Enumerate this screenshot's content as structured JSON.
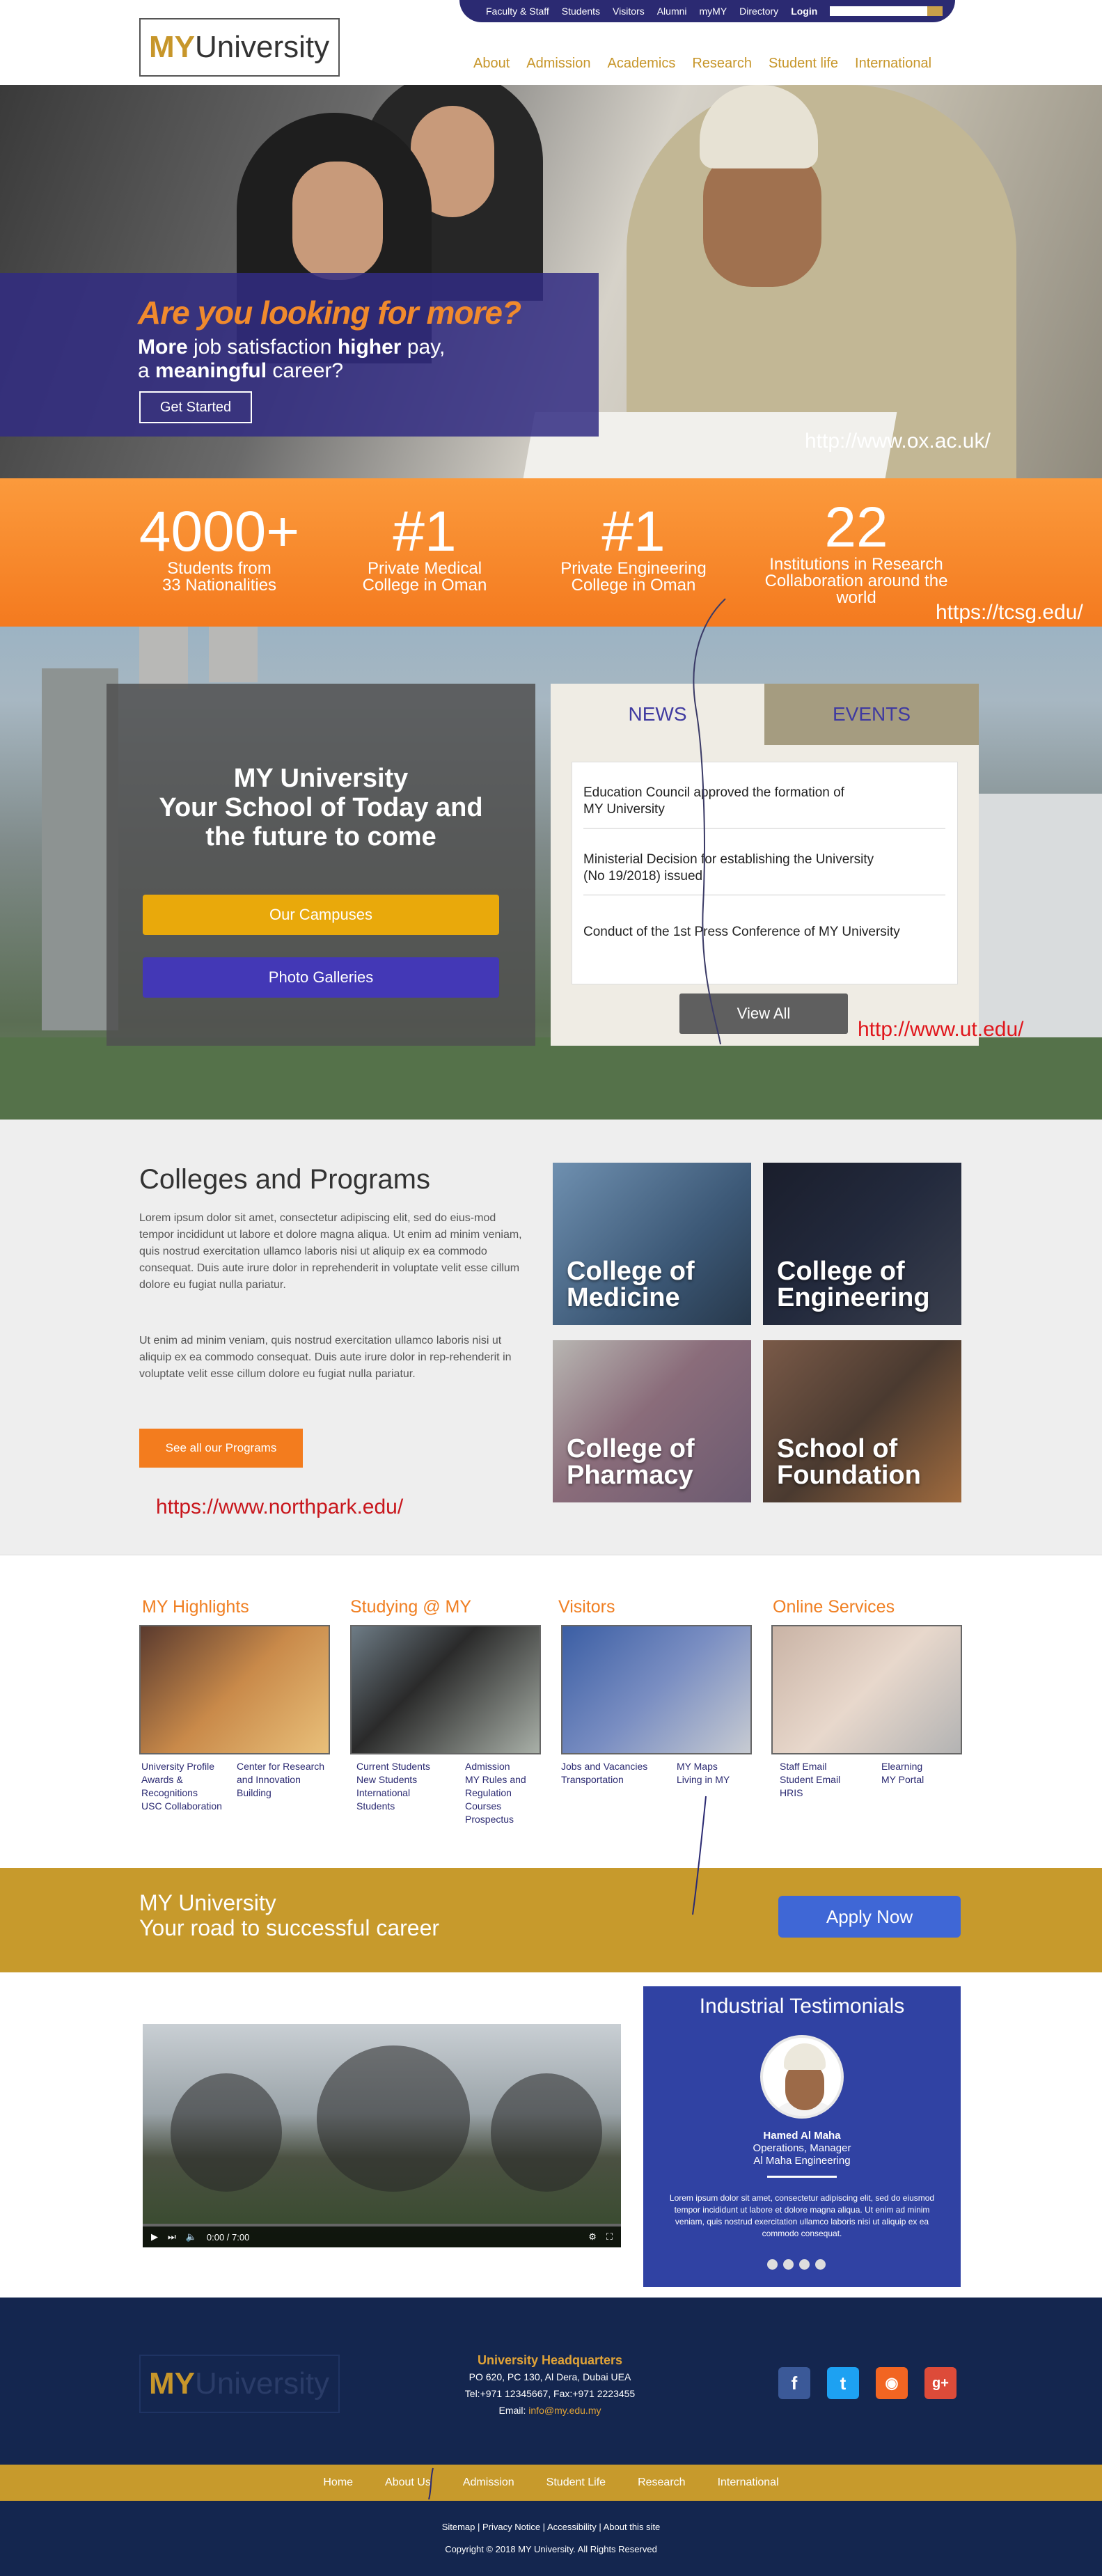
{
  "header": {
    "logo_my": "MY",
    "logo_rest": "University",
    "utility": [
      "Faculty & Staff",
      "Students",
      "Visitors",
      "Alumni",
      "myMY",
      "Directory"
    ],
    "login": "Login",
    "nav": [
      "About",
      "Admission",
      "Academics",
      "Research",
      "Student life",
      "International"
    ]
  },
  "hero": {
    "headline": "Are you looking for more?",
    "line1_a": "More",
    "line1_b": " job satisfaction ",
    "line1_c": "higher",
    "line1_d": " pay,",
    "line2_a": "a ",
    "line2_b": "meaningful",
    "line2_c": " career?",
    "button": "Get Started",
    "url": "http://www.ox.ac.uk/"
  },
  "stats": {
    "items": [
      {
        "num": "4000+",
        "l1": "Students from",
        "l2": "33 Nationalities",
        "l3": ""
      },
      {
        "num": "#1",
        "l1": "Private Medical",
        "l2": "College in Oman",
        "l3": ""
      },
      {
        "num": "#1",
        "l1": "Private Engineering",
        "l2": "College in Oman",
        "l3": ""
      },
      {
        "num": "22",
        "l1": "Institutions in Research",
        "l2": "Collaboration around the",
        "l3": "world"
      }
    ],
    "url": "https://tcsg.edu/"
  },
  "campus": {
    "title1": "MY University",
    "title2": "Your School of Today and",
    "title3": "the future to come",
    "btn_campuses": "Our Campuses",
    "btn_gallery": "Photo Galleries",
    "tab_news": "NEWS",
    "tab_events": "EVENTS",
    "news": [
      {
        "l1": "Education Council approved the formation of",
        "l2": "MY University"
      },
      {
        "l1": "Ministerial Decision for establishing the University",
        "l2": "(No 19/2018) issued"
      },
      {
        "l1": "Conduct of the 1st Press Conference of MY University",
        "l2": ""
      }
    ],
    "view_all": "View All",
    "url": "http://www.ut.edu/"
  },
  "colleges": {
    "title": "Colleges and Programs",
    "p1": "Lorem ipsum dolor sit amet, consectetur adipiscing elit, sed do eius-mod tempor incididunt ut labore et dolore magna aliqua. Ut enim ad minim veniam, quis nostrud exercitation ullamco laboris nisi ut aliquip ex ea commodo consequat. Duis aute irure dolor in reprehenderit in voluptate velit esse cillum dolore eu fugiat nulla pariatur.",
    "p2": "Ut enim ad minim veniam, quis nostrud exercitation ullamco laboris nisi ut aliquip ex ea commodo consequat. Duis aute irure dolor in rep-rehenderit in voluptate velit esse cillum dolore eu fugiat nulla pariatur.",
    "button": "See all our Programs",
    "url": "https://www.northpark.edu/",
    "tiles": [
      {
        "l1": "College of",
        "l2": "Medicine"
      },
      {
        "l1": "College of",
        "l2": "Engineering"
      },
      {
        "l1": "College of",
        "l2": "Pharmacy"
      },
      {
        "l1": "School of",
        "l2": "Foundation"
      }
    ]
  },
  "highlights": {
    "heads": [
      "MY Highlights",
      "Studying @ MY",
      "Visitors",
      "Online Services"
    ],
    "links": [
      {
        "a": [
          "University Profile",
          "Awards &",
          "Recognitions",
          "USC Collaboration"
        ],
        "b": [
          "Center for Research",
          "and Innovation",
          "Building"
        ]
      },
      {
        "a": [
          "Current Students",
          "New Students",
          "International",
          "Students"
        ],
        "b": [
          "Admission",
          "MY Rules and",
          "Regulation",
          "Courses",
          "Prospectus"
        ]
      },
      {
        "a": [
          "Jobs and Vacancies",
          "Transportation"
        ],
        "b": [
          "MY Maps",
          "Living in MY"
        ]
      },
      {
        "a": [
          "Staff Email",
          "Student Email",
          "HRIS"
        ],
        "b": [
          "Elearning",
          "MY Portal"
        ]
      }
    ]
  },
  "apply": {
    "t1": "MY University",
    "t2": "Your road to successful career",
    "button": "Apply Now"
  },
  "video": {
    "time": "0:00 / 7:00"
  },
  "testimonial": {
    "title": "Industrial Testimonials",
    "name": "Hamed Al Maha",
    "role1": "Operations, Manager",
    "role2": "Al Maha Engineering",
    "quote": "Lorem ipsum dolor sit amet, consectetur adipiscing elit, sed do eiusmod tempor incididunt ut labore et dolore magna aliqua. Ut enim ad minim veniam, quis nostrud exercitation ullamco laboris nisi ut aliquip ex ea commodo consequat."
  },
  "footer": {
    "hq_title": "University Headquarters",
    "hq_addr": "PO 620, PC 130, Al Dera, Dubai UEA",
    "hq_tel": "Tel:+971 12345667, Fax:+971 2223455",
    "hq_email_label": "Email: ",
    "hq_email": "info@my.edu.my",
    "nav": [
      "Home",
      "About Us",
      "Admission",
      "Student Life",
      "Research",
      "International"
    ],
    "links": "Sitemap  |  Privacy Notice  |  Accessibility  |  About this site",
    "copy": "Copyright © 2018 MY University.  All Rights Reserved"
  },
  "colors": {
    "gold": "#c79a2c",
    "orange": "#f47a1f",
    "navy": "#14264f",
    "purple": "#2b2a72",
    "blue": "#3042a3"
  },
  "icons": [
    "search-icon",
    "play-icon",
    "next-icon",
    "volume-icon",
    "settings-icon",
    "fullscreen-icon",
    "facebook-icon",
    "twitter-icon",
    "rss-icon",
    "googleplus-icon"
  ]
}
